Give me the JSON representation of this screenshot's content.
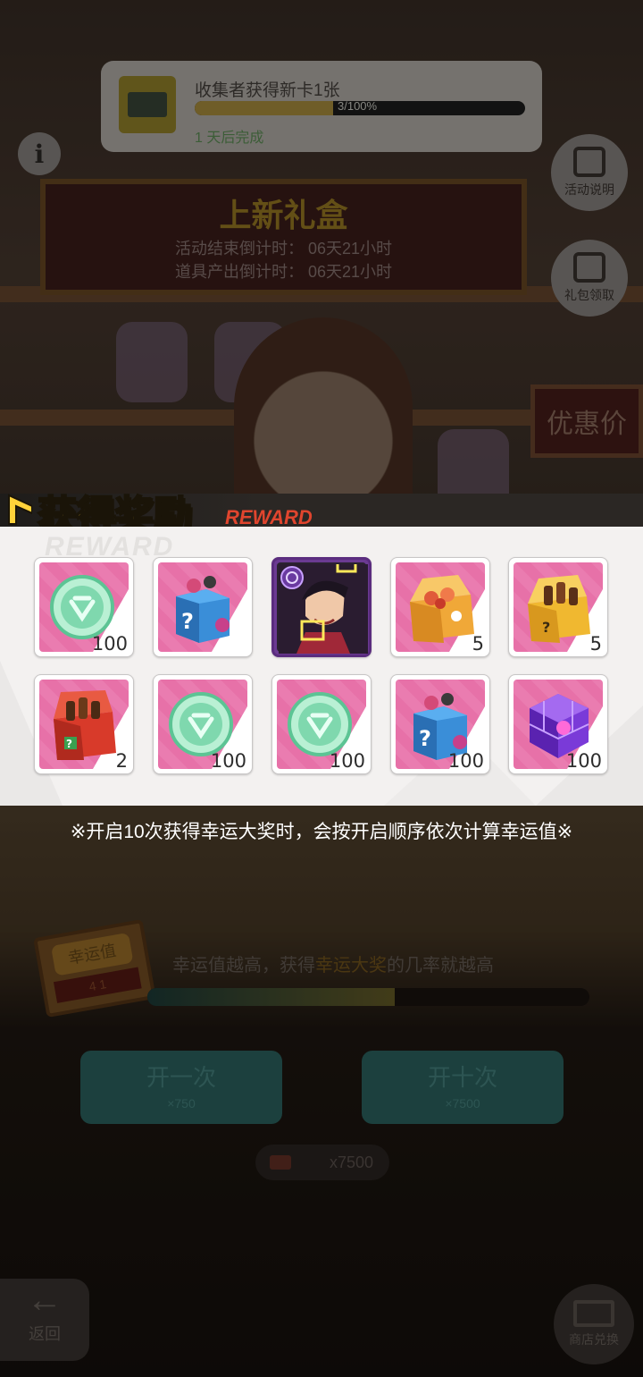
{
  "quest": {
    "title": "收集者获得新卡1张",
    "progress_text": "3/100%",
    "progress_fraction": 0.42,
    "note": "1 天后完成"
  },
  "info_button": {
    "label": "i"
  },
  "side_buttons": [
    {
      "label": "活动说明"
    },
    {
      "label": "礼包领取"
    }
  ],
  "event_banner": {
    "title": "上新礼盒",
    "line1": "活动结束倒计时：  06天21小时",
    "line2": "道具产出倒计时：  06天21小时"
  },
  "sign": {
    "label": "优惠价"
  },
  "reward_popup": {
    "title_cn": "获得奖励",
    "title_en": "REWARD",
    "watermark": "REWARD",
    "items": [
      {
        "name": "green-coin",
        "count": "100"
      },
      {
        "name": "blue-mystery-box",
        "count": ""
      },
      {
        "name": "character-card",
        "count": ""
      },
      {
        "name": "orange-food-box",
        "count": "5"
      },
      {
        "name": "gold-drink-box",
        "count": "5"
      },
      {
        "name": "red-treasure-chest",
        "count": "2"
      },
      {
        "name": "green-coin",
        "count": "100"
      },
      {
        "name": "green-coin",
        "count": "100"
      },
      {
        "name": "blue-mystery-box",
        "count": "100"
      },
      {
        "name": "purple-cube",
        "count": "100"
      }
    ],
    "notice": "※开启10次获得幸运大奖时，会按开启顺序依次计算幸运值※"
  },
  "luck": {
    "tag_label": "幸运值",
    "tag_value": "4 1",
    "text_prefix": "幸运值越高，获得",
    "text_highlight": "幸运大奖",
    "text_suffix": "的几率就越高",
    "fraction": 0.56
  },
  "open_buttons": [
    {
      "label": "开一次",
      "cost": "×750"
    },
    {
      "label": "开十次",
      "cost": "×7500"
    }
  ],
  "balance": {
    "value": "x7500"
  },
  "back_button": {
    "arrow": "←",
    "label": "返回"
  },
  "corner_button": {
    "label": "商店兑换"
  },
  "colors": {
    "reward_title": "#ffd23a",
    "reward_en": "#e0452e",
    "tile_pink": "#e771a8",
    "rare_frame": "#5a2c7e"
  }
}
